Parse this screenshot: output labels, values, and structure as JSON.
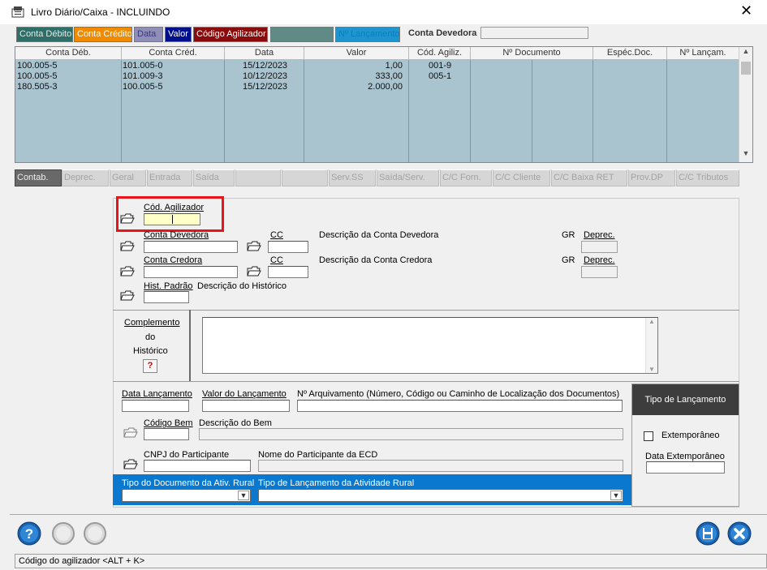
{
  "window": {
    "title": "Livro Diário/Caixa  -  INCLUINDO"
  },
  "top_tabs": [
    {
      "label": "Conta Débito",
      "bg": "#2e6e66",
      "fg": "#e8e8e8"
    },
    {
      "label": "Conta Crédito",
      "bg": "#f08a00",
      "fg": "#ffffff"
    },
    {
      "label": "Data",
      "bg": "#8e8eb8",
      "fg": "#3b3b7a"
    },
    {
      "label": "Valor",
      "bg": "#00108a",
      "fg": "#ffffff"
    },
    {
      "label": "Código Agilizador",
      "bg": "#8a0b0b",
      "fg": "#ffffff"
    },
    {
      "label": "",
      "bg": "#5f8a86",
      "fg": "#ffffff"
    },
    {
      "label": "Nº Lançamento",
      "bg": "#1f95d0",
      "fg": "#0b7ebf"
    }
  ],
  "conta_devedora": {
    "label": "Conta Devedora",
    "value": ""
  },
  "grid": {
    "headers": [
      "Conta Déb.",
      "Conta Créd.",
      "Data",
      "Valor",
      "Cód. Agiliz.",
      "Nº Documento",
      "Espéc.Doc.",
      "Nº Lançam."
    ],
    "rows": [
      [
        "100.005-5",
        "101.005-0",
        "15/12/2023",
        "1,00",
        "001-9",
        "",
        "",
        ""
      ],
      [
        "100.005-5",
        "101.009-3",
        "10/12/2023",
        "333,00",
        "005-1",
        "",
        "",
        ""
      ],
      [
        "180.505-3",
        "100.005-5",
        "15/12/2023",
        "2.000,00",
        "",
        "",
        "",
        ""
      ]
    ]
  },
  "sub_tabs": [
    "Contab.",
    "Deprec.",
    "Geral",
    "Entrada",
    "Saída",
    "",
    "",
    "Serv.SS",
    "Saída/Serv.",
    "C/C Forn.",
    "C/C Cliente",
    "C/C Baixa RET",
    "Prov.DP",
    "C/C Tributos"
  ],
  "form": {
    "cod_agilizador_label": "Cód. Agilizador",
    "cod_agilizador_value": "",
    "conta_devedora_label": "Conta Devedora",
    "cc_label": "CC",
    "desc_conta_devedora": "Descrição da Conta Devedora",
    "gr_label": "GR",
    "deprec_label": "Deprec.",
    "conta_credora_label": "Conta Credora",
    "desc_conta_credora": "Descrição da Conta Credora",
    "hist_padrao_label": "Hist. Padrão",
    "desc_historico": "Descrição do Histórico",
    "complemento_l1": "Complemento",
    "complemento_l2": "do",
    "complemento_l3": "Histórico",
    "help_mark": "?",
    "data_lancamento_label": "Data Lançamento",
    "valor_lancamento_label": "Valor do Lançamento",
    "arquivamento_label": "Nº Arquivamento (Número, Código ou Caminho de Localização dos Documentos)",
    "codigo_bem_label": "Código Bem",
    "descricao_bem_label": "Descrição do Bem",
    "cnpj_label": "CNPJ do Participante",
    "nome_participante_label": "Nome do Participante da ECD",
    "tipo_doc_rural_label": "Tipo do Documento da Ativ. Rural",
    "tipo_lanc_rural_label": "Tipo de Lançamento da Atividade Rural",
    "tipo_lancamento_head": "Tipo de Lançamento",
    "extemporaneo_label": "Extemporâneo",
    "data_extemporaneo_label": "Data Extemporâneo"
  },
  "status_bar": {
    "text": "Código do agilizador  <ALT + K>"
  },
  "colors": {
    "highlight_box": "#e8141a",
    "grid_bg": "#a9c3cf",
    "accent_blue": "#0b78cf"
  }
}
